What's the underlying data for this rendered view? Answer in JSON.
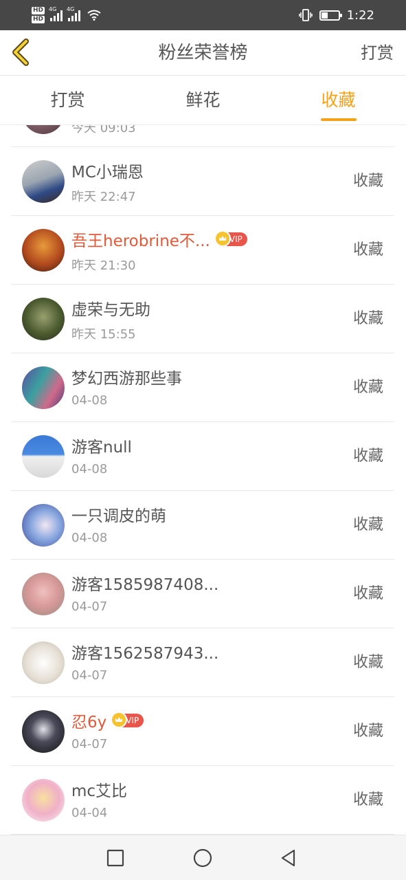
{
  "status_bar": {
    "hd1": "HD",
    "hd2": "HD",
    "net1": "4G",
    "net2": "4G",
    "time": "1:22"
  },
  "header": {
    "title": "粉丝荣誉榜",
    "action": "打赏"
  },
  "tabs": [
    {
      "label": "打赏",
      "active": false
    },
    {
      "label": "鲜花",
      "active": false
    },
    {
      "label": "收藏",
      "active": true
    }
  ],
  "list": {
    "partial_time": "今天 09:03",
    "items": [
      {
        "name": "MC小瑞恩",
        "time": "昨天 22:47",
        "vip": false,
        "action": "收藏"
      },
      {
        "name": "吾王herobrine不...",
        "time": "昨天 21:30",
        "vip": true,
        "vip_label": "VIP",
        "action": "收藏"
      },
      {
        "name": "虚荣与无助",
        "time": "昨天 15:55",
        "vip": false,
        "action": "收藏"
      },
      {
        "name": "梦幻西游那些事",
        "time": "04-08",
        "vip": false,
        "action": "收藏"
      },
      {
        "name": "游客null",
        "time": "04-08",
        "vip": false,
        "action": "收藏"
      },
      {
        "name": "一只调皮的萌",
        "time": "04-08",
        "vip": false,
        "action": "收藏"
      },
      {
        "name": "游客1585987408...",
        "time": "04-07",
        "vip": false,
        "action": "收藏"
      },
      {
        "name": "游客1562587943...",
        "time": "04-07",
        "vip": false,
        "action": "收藏"
      },
      {
        "name": "忍6y",
        "time": "04-07",
        "vip": true,
        "vip_label": "VIP",
        "action": "收藏"
      },
      {
        "name": "mc艾比",
        "time": "04-04",
        "vip": false,
        "action": "收藏"
      }
    ]
  },
  "colors": {
    "accent": "#f5a21b",
    "vip_name": "#e05a3a",
    "vip_badge": "#e8554a",
    "crown": "#f6c22f"
  },
  "icons": {
    "back": "chevron-left-icon",
    "nav_recent": "square-icon",
    "nav_home": "circle-icon",
    "nav_back": "triangle-back-icon"
  }
}
